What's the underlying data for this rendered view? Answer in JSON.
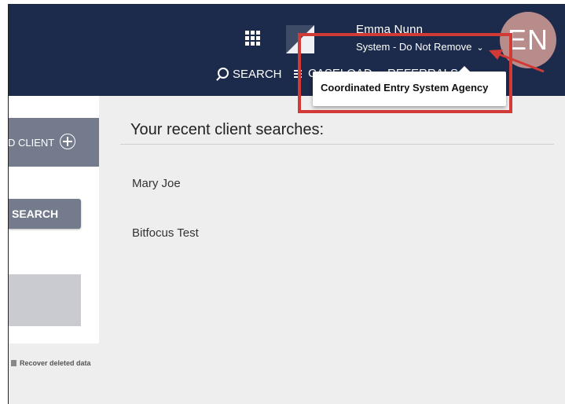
{
  "header": {
    "user_name": "Emma Nunn",
    "agency_name": "System - Do Not Remove",
    "avatar_initials": "EN",
    "nav": {
      "search": "SEARCH",
      "caseload": "CASELOAD",
      "referrals": "REFERRALS"
    }
  },
  "tooltip": {
    "text": "Coordinated Entry System Agency"
  },
  "sidebar": {
    "add_client": "D CLIENT",
    "search": "SEARCH",
    "recover": "Recover deleted data"
  },
  "recent": {
    "title": "Your recent client searches:",
    "items": [
      "Mary Joe",
      "Bitfocus Test"
    ]
  },
  "colors": {
    "header_bg": "#1c2b4b",
    "highlight": "#d23a36",
    "button_bg": "#737b8d",
    "avatar_bg": "#b98c8c"
  }
}
